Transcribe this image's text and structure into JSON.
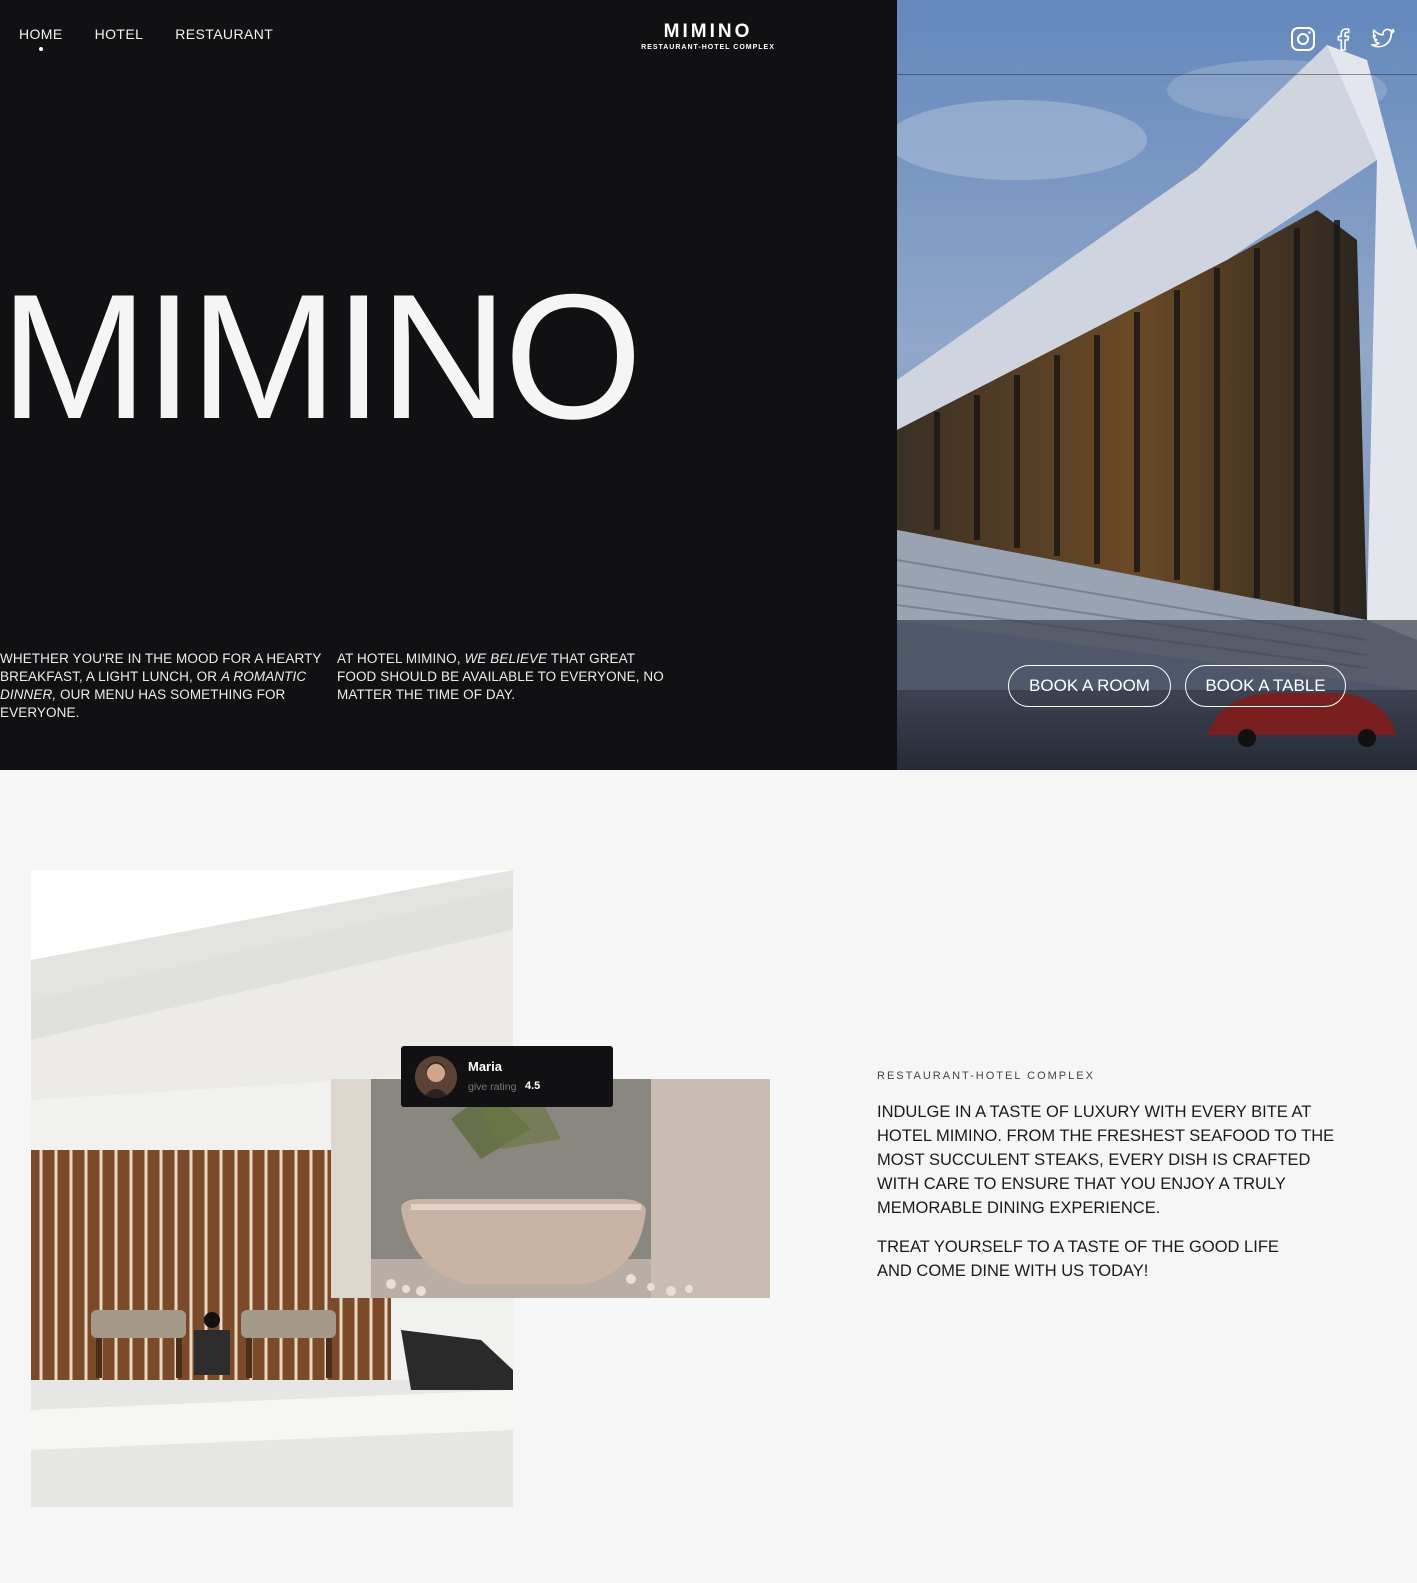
{
  "nav": {
    "items": [
      {
        "label": "HOME"
      },
      {
        "label": "HOTEL"
      },
      {
        "label": "RESTAURANT"
      }
    ]
  },
  "brand": {
    "name": "MIMINO",
    "subtitle": "RESTAURANT-HOTEL COMPLEX"
  },
  "hero": {
    "title": "MIMINO",
    "intro_left": {
      "a": "WHETHER YOU'RE IN THE MOOD FOR A HEARTY BREAKFAST, A LIGHT LUNCH, OR ",
      "b": "A ROMANTIC DINNER,",
      "c": " OUR MENU HAS SOMETHING FOR EVERYONE."
    },
    "intro_right": {
      "a": "AT HOTEL MIMINO, ",
      "b": "WE BELIEVE",
      "c": " THAT GREAT FOOD SHOULD BE AVAILABLE TO EVERYONE, NO MATTER THE TIME OF DAY."
    },
    "buttons": {
      "book_room": "BOOK A ROOM",
      "book_table": "BOOK A TABLE"
    },
    "socials": [
      "instagram-icon",
      "facebook-icon",
      "twitter-icon"
    ]
  },
  "review": {
    "name": "Maria",
    "rating_label": "give rating",
    "rating": "4.5"
  },
  "about": {
    "eyebrow": "RESTAURANT-HOTEL COMPLEX",
    "paragraph1": "INDULGE IN A TASTE OF LUXURY WITH EVERY BITE AT HOTEL MIMINO. FROM THE FRESHEST SEAFOOD TO THE MOST SUCCULENT STEAKS, EVERY DISH IS CRAFTED WITH CARE TO ENSURE THAT YOU ENJOY A TRULY MEMORABLE DINING EXPERIENCE.",
    "paragraph2": "TREAT YOURSELF TO A TASTE OF THE GOOD LIFE AND COME DINE WITH US TODAY!"
  },
  "colors": {
    "dark": "#111113",
    "light_bg": "#f6f6f6",
    "text_light": "#f2f2f2"
  }
}
